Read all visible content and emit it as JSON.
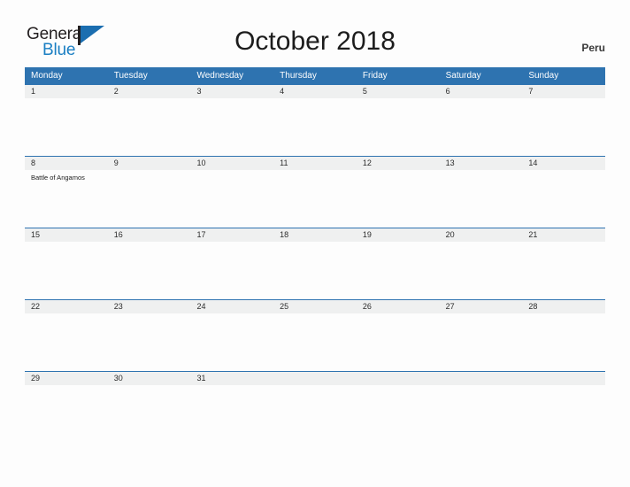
{
  "logo": {
    "word_top": "General",
    "word_bottom": "Blue",
    "mark": "flag-triangle-icon",
    "blue": "#1b7fc3",
    "dark": "#231f20"
  },
  "header": {
    "title": "October 2018",
    "country": "Peru"
  },
  "theme": {
    "header_blue": "#2e73b0",
    "date_band": "#eff0f0",
    "page_background": "#fdfdfd",
    "text": "#1c1c1c"
  },
  "calendar": {
    "weekdays": [
      "Monday",
      "Tuesday",
      "Wednesday",
      "Thursday",
      "Friday",
      "Saturday",
      "Sunday"
    ],
    "weeks": [
      {
        "dates": [
          "1",
          "2",
          "3",
          "4",
          "5",
          "6",
          "7"
        ],
        "events": [
          "",
          "",
          "",
          "",
          "",
          "",
          ""
        ]
      },
      {
        "dates": [
          "8",
          "9",
          "10",
          "11",
          "12",
          "13",
          "14"
        ],
        "events": [
          "Battle of Angamos",
          "",
          "",
          "",
          "",
          "",
          ""
        ]
      },
      {
        "dates": [
          "15",
          "16",
          "17",
          "18",
          "19",
          "20",
          "21"
        ],
        "events": [
          "",
          "",
          "",
          "",
          "",
          "",
          ""
        ]
      },
      {
        "dates": [
          "22",
          "23",
          "24",
          "25",
          "26",
          "27",
          "28"
        ],
        "events": [
          "",
          "",
          "",
          "",
          "",
          "",
          ""
        ]
      },
      {
        "dates": [
          "29",
          "30",
          "31",
          "",
          "",
          "",
          ""
        ],
        "events": [
          "",
          "",
          "",
          "",
          "",
          "",
          ""
        ]
      }
    ]
  }
}
